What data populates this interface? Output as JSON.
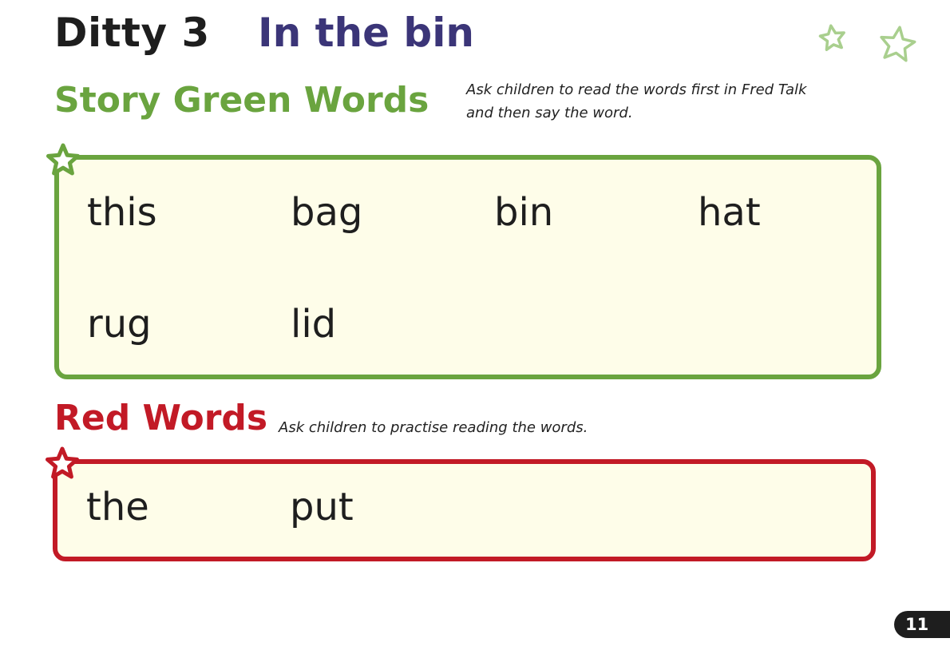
{
  "header": {
    "ditty_label": "Ditty 3",
    "story_title": "In the bin"
  },
  "green_section": {
    "heading": "Story Green Words",
    "instruction_line1": "Ask children to read the words first in Fred Talk",
    "instruction_line2": "and then say the word.",
    "words": [
      "this",
      "bag",
      "bin",
      "hat",
      "rug",
      "lid"
    ],
    "color": "#6aa43f"
  },
  "red_section": {
    "heading": "Red Words",
    "instruction": "Ask children to practise reading the words.",
    "words": [
      "the",
      "put"
    ],
    "color": "#c21a26"
  },
  "footer": {
    "page_number": "11"
  },
  "icons": {
    "box_marker": "star-icon",
    "decoration": "star-outline-icon"
  },
  "colors": {
    "title_purple": "#3b3578",
    "box_fill": "#fefde9",
    "star_deco": "#a9cf8e"
  }
}
